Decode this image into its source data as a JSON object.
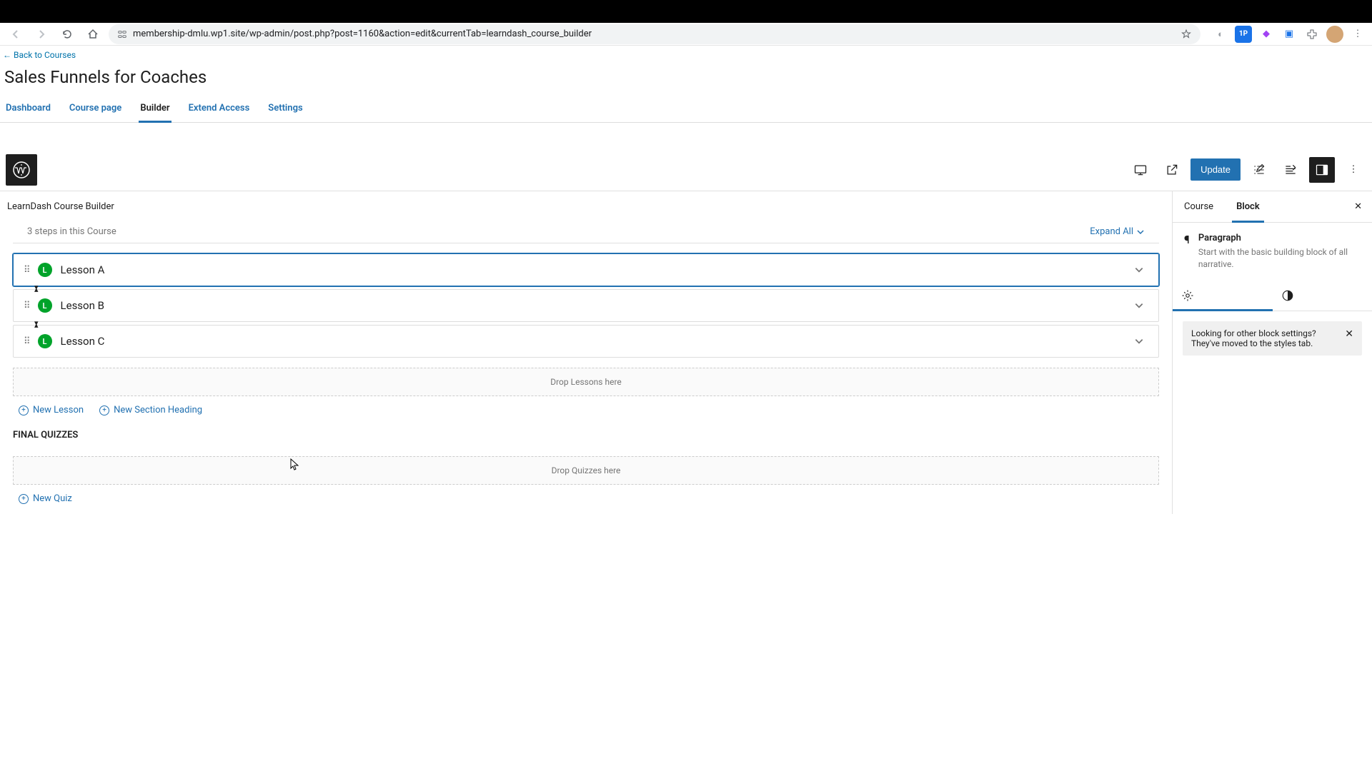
{
  "browser": {
    "url": "membership-dmlu.wp1.site/wp-admin/post.php?post=1160&action=edit&currentTab=learndash_course_builder"
  },
  "nav": {
    "back_to_courses": "← Back to Courses"
  },
  "page": {
    "title": "Sales Funnels for Coaches"
  },
  "tabs": {
    "dashboard": "Dashboard",
    "course_page": "Course page",
    "builder": "Builder",
    "extend_access": "Extend Access",
    "settings": "Settings"
  },
  "toolbar": {
    "update": "Update"
  },
  "builder": {
    "header": "LearnDash Course Builder",
    "steps": "3 steps in this Course",
    "expand_all": "Expand All",
    "lessons": [
      {
        "badge": "L",
        "name": "Lesson A"
      },
      {
        "badge": "L",
        "name": "Lesson B"
      },
      {
        "badge": "L",
        "name": "Lesson C"
      }
    ],
    "drop_lessons": "Drop Lessons here",
    "new_lesson": "New Lesson",
    "new_section": "New Section Heading",
    "final_quizzes": "FINAL QUIZZES",
    "drop_quizzes": "Drop Quizzes here",
    "new_quiz": "New Quiz"
  },
  "sidebar": {
    "tabs": {
      "course": "Course",
      "block": "Block"
    },
    "block": {
      "name": "Paragraph",
      "desc": "Start with the basic building block of all narrative."
    },
    "hint": "Looking for other block settings? They've moved to the styles tab."
  }
}
